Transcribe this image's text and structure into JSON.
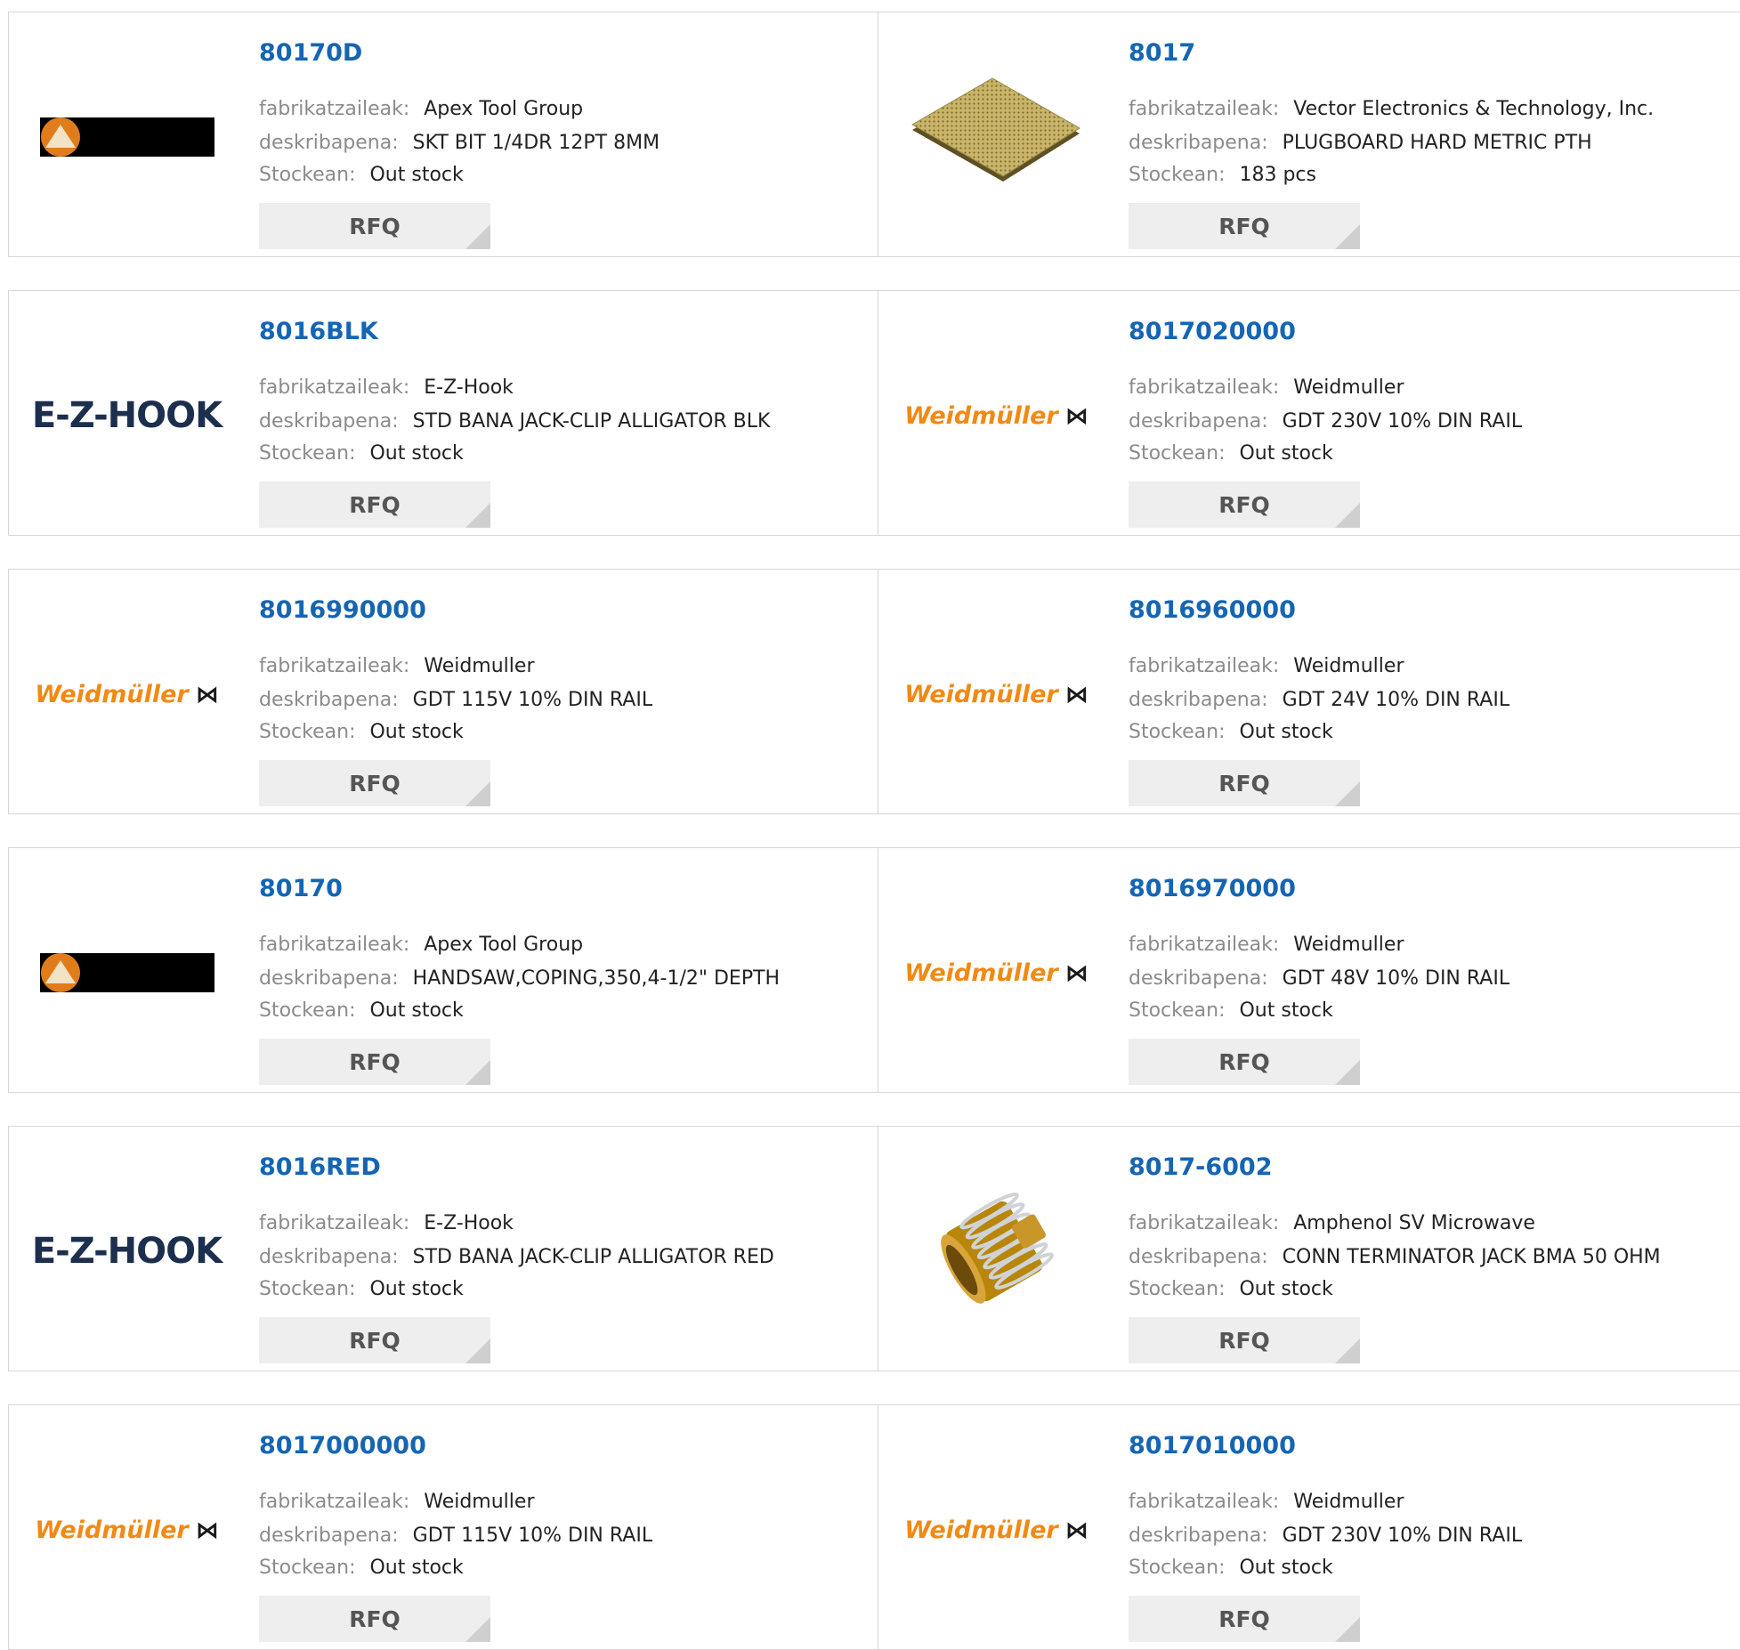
{
  "labels": {
    "manufacturer": "fabrikatzaileak:",
    "description": "deskribapena:",
    "stock": "Stockean:",
    "rfq": "RFQ"
  },
  "products": [
    {
      "part": "80170D",
      "manufacturer": "Apex Tool Group",
      "description": "SKT BIT 1/4DR 12PT 8MM",
      "stock": "Out stock",
      "logo": "apex-logo"
    },
    {
      "part": "8017",
      "manufacturer": "Vector Electronics & Technology, Inc.",
      "description": "PLUGBOARD HARD METRIC PTH",
      "stock": "183 pcs",
      "logo": "plugboard-photo"
    },
    {
      "part": "8016BLK",
      "manufacturer": "E-Z-Hook",
      "description": "STD BANA JACK-CLIP ALLIGATOR BLK",
      "stock": "Out stock",
      "logo": "ezhook-logo",
      "logo_text": "E-Z-HOOK"
    },
    {
      "part": "8017020000",
      "manufacturer": "Weidmuller",
      "description": "GDT 230V 10% DIN RAIL",
      "stock": "Out stock",
      "logo": "weidmuller-logo",
      "logo_text": "Weidmüller"
    },
    {
      "part": "8016990000",
      "manufacturer": "Weidmuller",
      "description": "GDT 115V 10% DIN RAIL",
      "stock": "Out stock",
      "logo": "weidmuller-logo",
      "logo_text": "Weidmüller"
    },
    {
      "part": "8016960000",
      "manufacturer": "Weidmuller",
      "description": "GDT 24V 10% DIN RAIL",
      "stock": "Out stock",
      "logo": "weidmuller-logo",
      "logo_text": "Weidmüller"
    },
    {
      "part": "80170",
      "manufacturer": "Apex Tool Group",
      "description": "HANDSAW,COPING,350,4-1/2\" DEPTH",
      "stock": "Out stock",
      "logo": "apex-logo"
    },
    {
      "part": "8016970000",
      "manufacturer": "Weidmuller",
      "description": "GDT 48V 10% DIN RAIL",
      "stock": "Out stock",
      "logo": "weidmuller-logo",
      "logo_text": "Weidmüller"
    },
    {
      "part": "8016RED",
      "manufacturer": "E-Z-Hook",
      "description": "STD BANA JACK-CLIP ALLIGATOR RED",
      "stock": "Out stock",
      "logo": "ezhook-logo",
      "logo_text": "E-Z-HOOK"
    },
    {
      "part": "8017-6002",
      "manufacturer": "Amphenol SV Microwave",
      "description": "CONN TERMINATOR JACK BMA 50 OHM",
      "stock": "Out stock",
      "logo": "connector-photo"
    },
    {
      "part": "8017000000",
      "manufacturer": "Weidmuller",
      "description": "GDT 115V 10% DIN RAIL",
      "stock": "Out stock",
      "logo": "weidmuller-logo",
      "logo_text": "Weidmüller"
    },
    {
      "part": "8017010000",
      "manufacturer": "Weidmuller",
      "description": "GDT 230V 10% DIN RAIL",
      "stock": "Out stock",
      "logo": "weidmuller-logo",
      "logo_text": "Weidmüller"
    }
  ],
  "colors": {
    "part_link": "#1565b3",
    "label": "#8b8b8b",
    "value": "#222222",
    "rfq_bg": "#eeeeee",
    "weidmuller_orange": "#f08a14",
    "ezhook_navy": "#1d2f4f",
    "apex_orange": "#e07d1a"
  }
}
